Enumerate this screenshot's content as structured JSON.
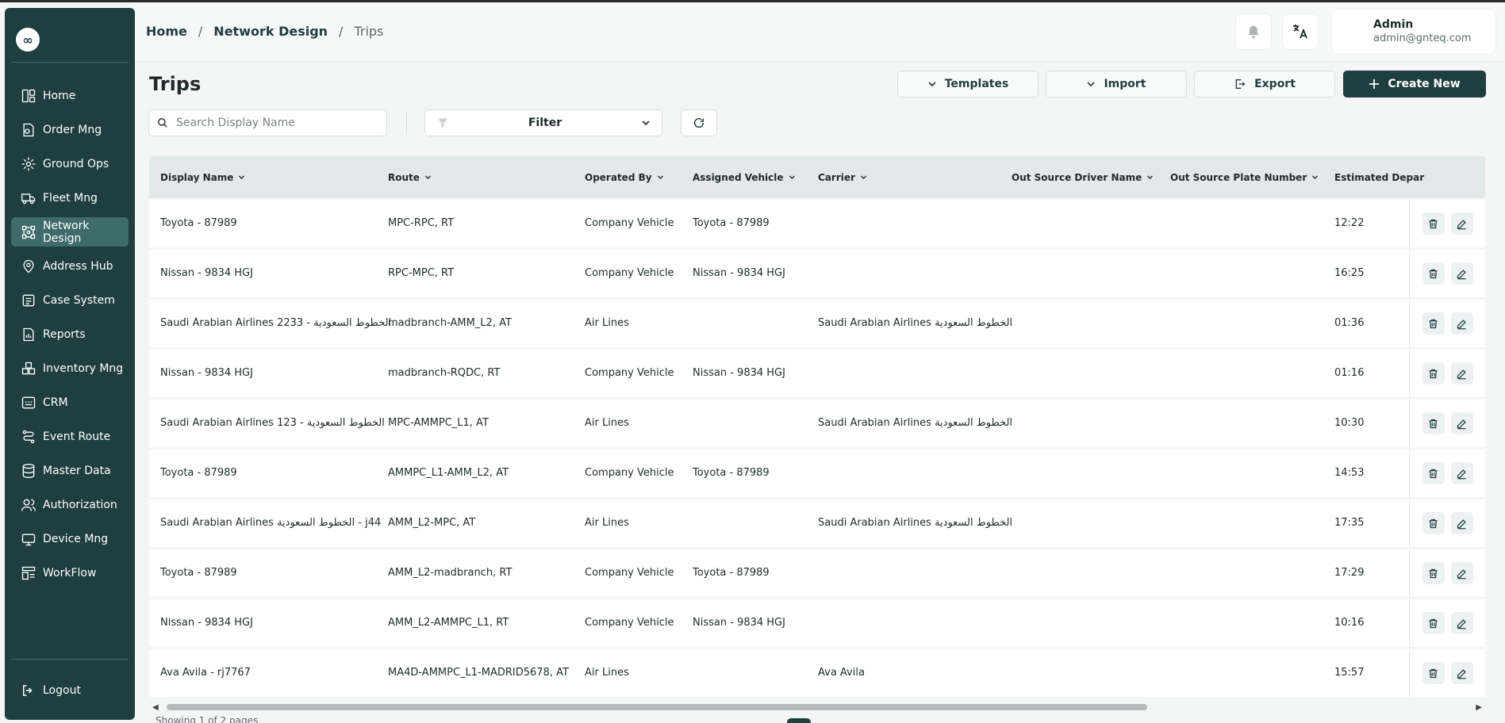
{
  "sidebar": {
    "logo": "∞",
    "items": [
      {
        "label": "Home",
        "icon": "home-icon"
      },
      {
        "label": "Order Mng",
        "icon": "order-icon"
      },
      {
        "label": "Ground Ops",
        "icon": "ground-ops-icon"
      },
      {
        "label": "Fleet Mng",
        "icon": "truck-icon"
      },
      {
        "label": "Network Design",
        "icon": "network-icon",
        "active": true
      },
      {
        "label": "Address Hub",
        "icon": "address-icon"
      },
      {
        "label": "Case System",
        "icon": "case-icon"
      },
      {
        "label": "Reports",
        "icon": "reports-icon"
      },
      {
        "label": "Inventory Mng",
        "icon": "inventory-icon"
      },
      {
        "label": "CRM",
        "icon": "crm-icon"
      },
      {
        "label": "Event Route",
        "icon": "route-icon"
      },
      {
        "label": "Master Data",
        "icon": "database-icon"
      },
      {
        "label": "Authorization",
        "icon": "users-icon"
      },
      {
        "label": "Device Mng",
        "icon": "device-icon"
      },
      {
        "label": "WorkFlow",
        "icon": "workflow-icon"
      }
    ],
    "logout": "Logout"
  },
  "header": {
    "breadcrumb": [
      "Home",
      "Network Design",
      "Trips"
    ],
    "breadcrumb_sep": "/",
    "user_name": "Admin",
    "user_email": "admin@gnteq.com"
  },
  "page": {
    "title": "Trips",
    "templates_label": "Templates",
    "import_label": "Import",
    "export_label": "Export",
    "create_label": "Create New"
  },
  "toolbar": {
    "search_placeholder": "Search Display Name",
    "filter_label": "Filter"
  },
  "table": {
    "columns": [
      "Display Name",
      "Route",
      "Operated By",
      "Assigned Vehicle",
      "Carrier",
      "Out Source Driver Name",
      "Out Source Plate Number",
      "Estimated Depar"
    ],
    "rows": [
      [
        "Toyota - 87989",
        "MPC-RPC, RT",
        "Company Vehicle",
        "Toyota - 87989",
        "",
        "",
        "",
        "12:22"
      ],
      [
        "Nissan - 9834 HGJ",
        "RPC-MPC, RT",
        "Company Vehicle",
        "Nissan - 9834 HGJ",
        "",
        "",
        "",
        "16:25"
      ],
      [
        "Saudi Arabian Airlines 2233 - الخطوط السعودية",
        "madbranch-AMM_L2, AT",
        "Air Lines",
        "",
        "Saudi Arabian Airlines الخطوط السعودية",
        "",
        "",
        "01:36"
      ],
      [
        "Nissan - 9834 HGJ",
        "madbranch-RQDC, RT",
        "Company Vehicle",
        "Nissan - 9834 HGJ",
        "",
        "",
        "",
        "01:16"
      ],
      [
        "Saudi Arabian Airlines 123 - الخطوط السعودية",
        "MPC-AMMPC_L1, AT",
        "Air Lines",
        "",
        "Saudi Arabian Airlines الخطوط السعودية",
        "",
        "",
        "10:30"
      ],
      [
        "Toyota - 87989",
        "AMMPC_L1-AMM_L2, AT",
        "Company Vehicle",
        "Toyota - 87989",
        "",
        "",
        "",
        "14:53"
      ],
      [
        "Saudi Arabian Airlines الخطوط السعودية - j44",
        "AMM_L2-MPC, AT",
        "Air Lines",
        "",
        "Saudi Arabian Airlines الخطوط السعودية",
        "",
        "",
        "17:35"
      ],
      [
        "Toyota - 87989",
        "AMM_L2-madbranch, RT",
        "Company Vehicle",
        "Toyota - 87989",
        "",
        "",
        "",
        "17:29"
      ],
      [
        "Nissan - 9834 HGJ",
        "AMM_L2-AMMPC_L1, RT",
        "Company Vehicle",
        "Nissan - 9834 HGJ",
        "",
        "",
        "",
        "10:16"
      ],
      [
        "Ava Avila - rj7767",
        "MA4D-AMMPC_L1-MADRID5678, AT",
        "Air Lines",
        "",
        "Ava Avila",
        "",
        "",
        "15:57"
      ]
    ]
  },
  "footer": {
    "showing": "Showing 1 of 2 pages"
  },
  "colors": {
    "sidebar_bg": "#1e3e3f",
    "active_item": "#3f6b6b",
    "primary": "#1e3e3f"
  }
}
